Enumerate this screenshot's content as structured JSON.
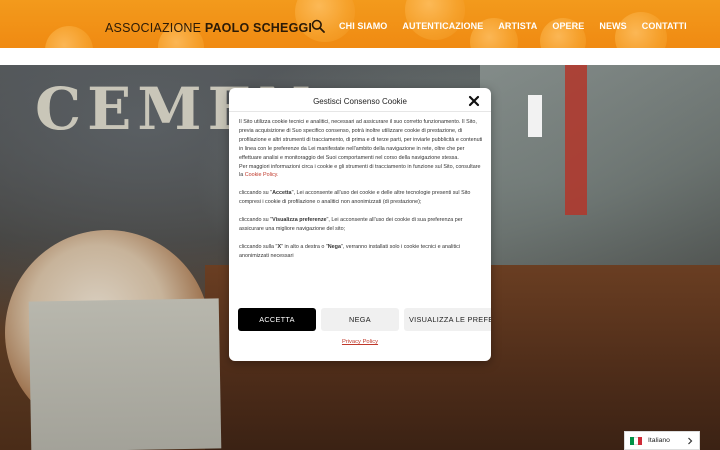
{
  "header": {
    "logo_prefix": "ASSOCIAZIONE ",
    "logo_name": "PAOLO SCHEGGI",
    "nav": [
      "CHI SIAMO",
      "AUTENTICAZIONE",
      "ARTISTA",
      "OPERE",
      "NEWS",
      "CONTATTI"
    ],
    "search_icon": "search-icon"
  },
  "artwork": {
    "stencil_text": "CEMEN"
  },
  "modal": {
    "title": "Gestisci Consenso Cookie",
    "p1": "Il Sito utilizza cookie tecnici e analitici, necessari ad assicurare il suo corretto funzionamento. Il Sito, previa acquisizione di Suo specifico consenso, potrà inoltre utilizzare cookie di prestazione, di profilazione e altri strumenti di tracciamento, di prima e di terze parti, per inviarle pubblicità e contenuti in linea con le preferenze da Lei manifestate nell'ambito della navigazione in rete, oltre che per effettuare analisi e monitoraggio dei Suoi comportamenti nel corso della navigazione stessa.",
    "p2_prefix": "Per maggiori informazioni circa i cookie e gli strumenti di tracciamento in funzione sul Sito, consultare la ",
    "p2_link": "Cookie Policy.",
    "p3_prefix": "cliccando su \"",
    "p3_bold": "Accetta",
    "p3_suffix": "\", Lei acconsente all'uso dei cookie e delle altre tecnologie presenti sul Sito compresi i cookie di profilazione o analitici non anonimizzati (di prestazione);",
    "p4_prefix": "cliccando su \"",
    "p4_bold": "Visualizza preferenze",
    "p4_suffix": "\", Lei acconsente all'uso dei cookie di sua preferenza per assicurare una migliore navigazione del sito;",
    "p5_prefix": "cliccando sulla \"",
    "p5_bold1": "X",
    "p5_mid": "\" in alto a destra o \"",
    "p5_bold2": "Nega",
    "p5_suffix": "\", verranno installati solo i cookie tecnici e analitici anonimizzati necessari",
    "accept_label": "ACCETTA",
    "deny_label": "NEGA",
    "prefs_label": "VISUALIZZA LE PREFERENZE",
    "privacy_label": "Privacy Policy"
  },
  "language": {
    "label": "Italiano",
    "flag_colors": [
      "#009246",
      "#ffffff",
      "#ce2b37"
    ]
  },
  "colors": {
    "header_orange": "#f08a12",
    "link_red": "#c0392b",
    "accept_bg": "#000000"
  }
}
